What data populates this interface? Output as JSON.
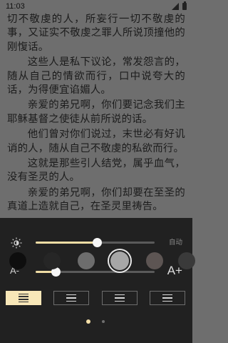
{
  "status_bar": {
    "time": "11:03"
  },
  "reader": {
    "paragraphs": [
      {
        "text": "切不敬虔的人，所妄行一切不敬虔的事，又证实不敬虔之罪人所说顶撞他的刚愎话。",
        "indent": false
      },
      {
        "text": "这些人是私下议论，常发怨言的，随从自己的情欲而行，口中说夸大的话，为得便宜谄媚人。",
        "indent": true
      },
      {
        "text": "亲爱的弟兄啊，你们要记念我们主耶稣基督之使徒从前所说的话。",
        "indent": true
      },
      {
        "text": "他们曾对你们说过，末世必有好讥诮的人，随从自己不敬虔的私欲而行。",
        "indent": true
      },
      {
        "text": "这就是那些引人结党，属乎血气，没有圣灵的人。",
        "indent": true
      },
      {
        "text": "亲爱的弟兄啊，你们却要在至圣的真道上造就自己，在圣灵里祷告。",
        "indent": true
      }
    ]
  },
  "settings_panel": {
    "brightness": {
      "icon": "brightness-icon",
      "value_fraction": 0.52,
      "auto_label": "自动"
    },
    "font_size": {
      "minus_label": "A-",
      "plus_label": "A+",
      "value_fraction": 0.17
    },
    "themes": [
      {
        "name": "theme-black",
        "color": "#0e0e0e",
        "selected": false
      },
      {
        "name": "theme-charcoal",
        "color": "#262626",
        "selected": false
      },
      {
        "name": "theme-gray",
        "color": "#6d6d6d",
        "selected": false
      },
      {
        "name": "theme-light-gray",
        "color": "#a7a7a7",
        "selected": true
      },
      {
        "name": "theme-taupe",
        "color": "#5d5553",
        "selected": false
      },
      {
        "name": "theme-dark-partial",
        "color": "#3a3a3a",
        "selected": false
      }
    ],
    "spacing_layouts": [
      {
        "name": "spacing-compact",
        "lines": 4,
        "active": true
      },
      {
        "name": "spacing-normal",
        "lines": 3,
        "active": false
      },
      {
        "name": "spacing-loose",
        "lines": 3,
        "active": false
      },
      {
        "name": "spacing-wide",
        "lines": 3,
        "active": false
      }
    ],
    "page_dots": {
      "count": 2,
      "active_index": 0
    },
    "colors": {
      "accent": "#efdca4",
      "panel_bg": "#212121",
      "reader_text": "#1c1c1c"
    }
  }
}
